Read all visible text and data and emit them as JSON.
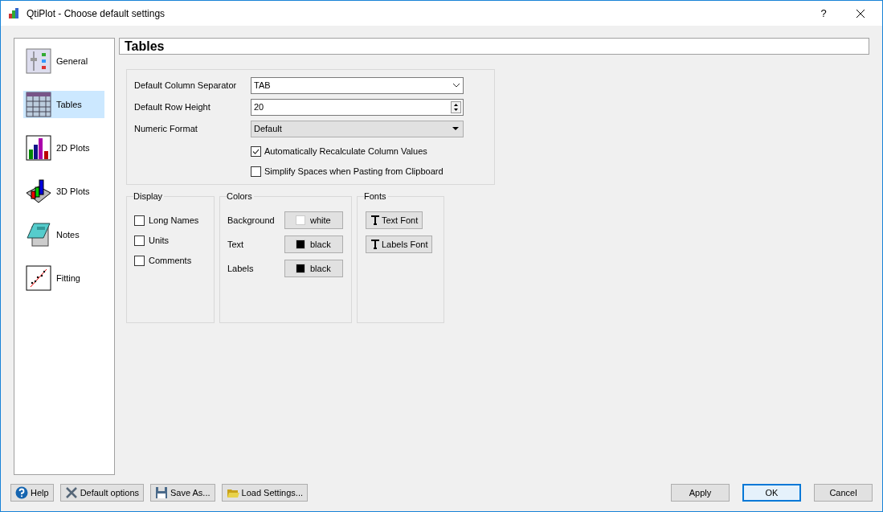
{
  "window": {
    "title": "QtiPlot - Choose default settings",
    "help_glyph": "?"
  },
  "sidebar": {
    "items": [
      {
        "label": "General",
        "kind": "general",
        "selected": false
      },
      {
        "label": "Tables",
        "kind": "tables",
        "selected": true
      },
      {
        "label": "2D Plots",
        "kind": "plots2d",
        "selected": false
      },
      {
        "label": "3D Plots",
        "kind": "plots3d",
        "selected": false
      },
      {
        "label": "Notes",
        "kind": "notes",
        "selected": false
      },
      {
        "label": "Fitting",
        "kind": "fitting",
        "selected": false
      }
    ]
  },
  "panel": {
    "title": "Tables",
    "column_separator": {
      "label": "Default Column Separator",
      "value": "TAB"
    },
    "row_height": {
      "label": "Default Row Height",
      "value": "20"
    },
    "numeric_format": {
      "label": "Numeric Format",
      "value": "Default"
    },
    "checks": [
      {
        "label": "Automatically Recalculate Column Values",
        "checked": true
      },
      {
        "label": "Simplify Spaces when Pasting from Clipboard",
        "checked": false
      }
    ],
    "display": {
      "title": "Display",
      "options": [
        {
          "label": "Long Names",
          "checked": false
        },
        {
          "label": "Units",
          "checked": false
        },
        {
          "label": "Comments",
          "checked": false
        }
      ]
    },
    "colors": {
      "title": "Colors",
      "rows": [
        {
          "label": "Background",
          "value": "white",
          "color": "#ffffff"
        },
        {
          "label": "Text",
          "value": "black",
          "color": "#000000"
        },
        {
          "label": "Labels",
          "value": "black",
          "color": "#000000"
        }
      ]
    },
    "fonts": {
      "title": "Fonts",
      "buttons": [
        "Text Font",
        "Labels Font"
      ]
    }
  },
  "footer": {
    "left_buttons": [
      {
        "label": "Help",
        "kind": "help"
      },
      {
        "label": "Default options",
        "kind": "tools"
      },
      {
        "label": "Save As...",
        "kind": "save"
      },
      {
        "label": "Load Settings...",
        "kind": "open"
      }
    ],
    "right_buttons": [
      {
        "label": "Apply",
        "default": false
      },
      {
        "label": "OK",
        "default": true
      },
      {
        "label": "Cancel",
        "default": false
      }
    ]
  }
}
